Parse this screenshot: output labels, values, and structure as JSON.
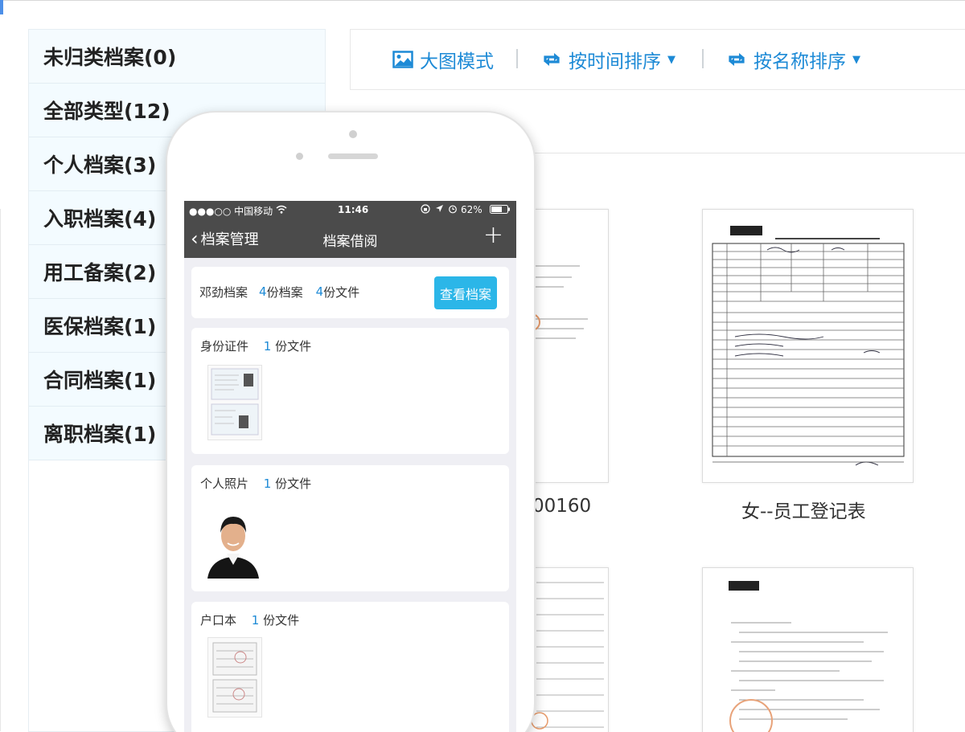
{
  "sidebar": {
    "categories": [
      {
        "label": "未归类档案(0)"
      },
      {
        "label": "全部类型(12)"
      },
      {
        "label": "个人档案(3)"
      },
      {
        "label": "入职档案(4)"
      },
      {
        "label": "用工备案(2)"
      },
      {
        "label": "医保档案(1)"
      },
      {
        "label": "合同档案(1)"
      },
      {
        "label": "离职档案(1)"
      }
    ]
  },
  "toolbar": {
    "large_view": "大图模式",
    "sort_time": "按时间排序",
    "sort_name": "按名称排序"
  },
  "grid": {
    "captions": [
      "00160",
      "女--员工登记表"
    ]
  },
  "phone": {
    "status": {
      "carrier": "●●●○○ 中国移动",
      "time": "11:46",
      "battery": "62%"
    },
    "nav": {
      "back_label": "档案管理",
      "title": "档案借阅",
      "add": "+"
    },
    "summary": {
      "name": "邓劲档案",
      "archive_count": "4",
      "archive_unit": "份档案",
      "file_count": "4",
      "file_unit": "份文件",
      "view_button": "查看档案"
    },
    "sections": [
      {
        "title": "身份证件",
        "count": "1",
        "unit": "份文件"
      },
      {
        "title": "个人照片",
        "count": "1",
        "unit": "份文件"
      },
      {
        "title": "户口本",
        "count": "1",
        "unit": "份文件"
      }
    ]
  },
  "colors": {
    "accent": "#1d8ad6",
    "button": "#2bb6e8",
    "navbar": "#4b4b4b",
    "sidebar_bg": "#f3fbff"
  }
}
